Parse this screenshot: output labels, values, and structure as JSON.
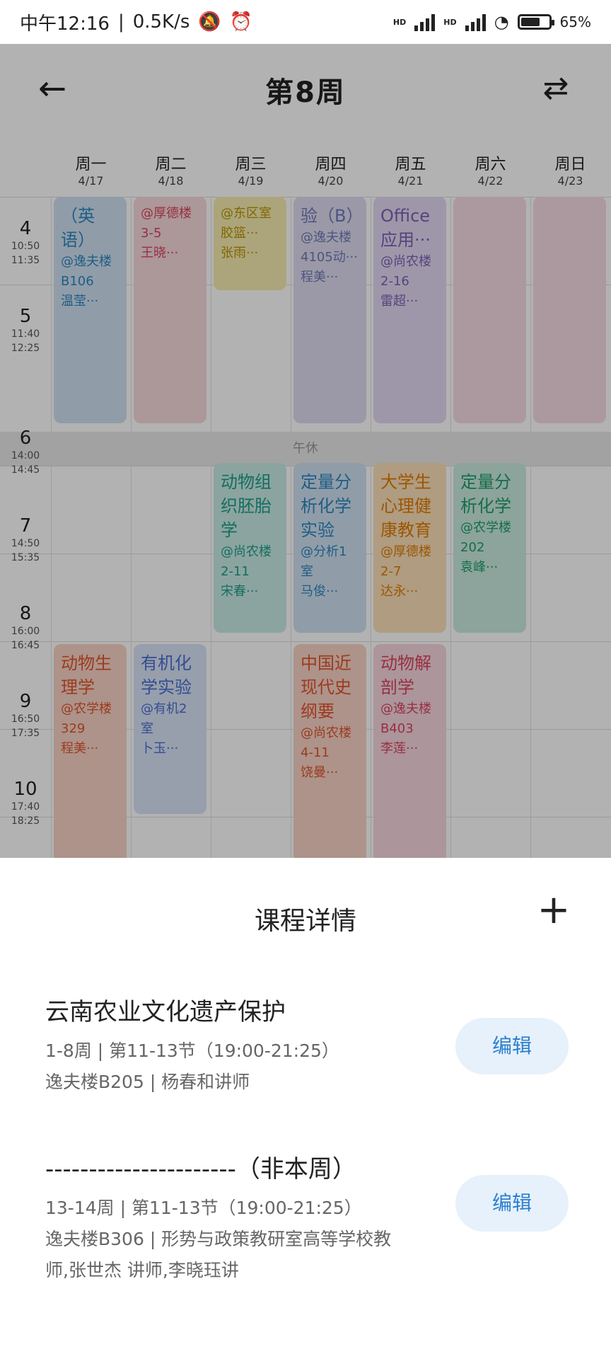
{
  "status_bar": {
    "time": "中午12:16",
    "speed": "0.5K/s",
    "battery": "65%",
    "signal1": "HD",
    "signal2": "HD",
    "icons": [
      "bell-off-icon",
      "alarm-icon",
      "signal-icon",
      "wifi-icon",
      "battery-icon"
    ]
  },
  "header": {
    "title": "第8周",
    "back_icon": "back-arrow-icon",
    "switch_icon": "swap-icon"
  },
  "days": [
    {
      "name": "周一",
      "date": "4/17"
    },
    {
      "name": "周二",
      "date": "4/18"
    },
    {
      "name": "周三",
      "date": "4/19"
    },
    {
      "name": "周四",
      "date": "4/20"
    },
    {
      "name": "周五",
      "date": "4/21"
    },
    {
      "name": "周六",
      "date": "4/22"
    },
    {
      "name": "周日",
      "date": "4/23"
    }
  ],
  "slots": [
    {
      "no": "4",
      "start": "10:50",
      "end": "11:35"
    },
    {
      "no": "5",
      "start": "11:40",
      "end": "12:25"
    },
    {
      "no": "6",
      "start": "14:00",
      "end": "14:45"
    },
    {
      "no": "7",
      "start": "14:50",
      "end": "15:35"
    },
    {
      "no": "8",
      "start": "16:00",
      "end": "16:45"
    },
    {
      "no": "9",
      "start": "16:50",
      "end": "17:35"
    },
    {
      "no": "10",
      "start": "17:40",
      "end": "18:25"
    }
  ],
  "lunch_label": "午休",
  "cards": [
    {
      "name": "（英语）",
      "loc": "@逸夫楼B106",
      "teacher": "温莹···",
      "color": "#2e86c1"
    },
    {
      "name": "",
      "loc": "@厚德楼3-5",
      "teacher": "王晓···",
      "color": "#d9465f"
    },
    {
      "name": "",
      "loc": "@东区室胶篮···",
      "teacher": "张雨···",
      "color": "#b89400"
    },
    {
      "name": "验（B）",
      "loc": "@逸夫楼4105动···",
      "teacher": "程美···",
      "color": "#6e79b8"
    },
    {
      "name": "Office应用···",
      "loc": "@尚农楼2-16",
      "teacher": "雷超···",
      "color": "#7a62b5"
    },
    {
      "name": "动物组织胚胎学",
      "loc": "@尚农楼2-11",
      "teacher": "宋春···",
      "color": "#1f9c8c"
    },
    {
      "name": "定量分析化学实验",
      "loc": "@分析1室",
      "teacher": "马俊···",
      "color": "#2e86c1"
    },
    {
      "name": "大学生心理健康教育",
      "loc": "@厚德楼2-7",
      "teacher": "达永···",
      "color": "#e07b00"
    },
    {
      "name": "定量分析化学",
      "loc": "@农学楼202",
      "teacher": "袁峰···",
      "color": "#1f9c6c"
    },
    {
      "name": "动物生理学",
      "loc": "@农学楼329",
      "teacher": "程美···",
      "color": "#e0542f"
    },
    {
      "name": "有机化学实验",
      "loc": "@有机2室",
      "teacher": "卜玉···",
      "color": "#4a6fd0"
    },
    {
      "name": "中国近现代史纲要",
      "loc": "@尚农楼4-11",
      "teacher": "饶曼···",
      "color": "#e0542f"
    },
    {
      "name": "动物解剖学",
      "loc": "@逸夫楼B403",
      "teacher": "李莲···",
      "color": "#d9465f"
    }
  ],
  "sheet": {
    "title": "课程详情",
    "add_icon": "plus-icon",
    "courses": [
      {
        "name": "云南农业文化遗产保护",
        "line1": "1-8周 | 第11-13节（19:00-21:25）",
        "line2": "逸夫楼B205 | 杨春和讲师",
        "edit": "编辑"
      },
      {
        "name": "----------------------（非本周）",
        "line1": "13-14周 | 第11-13节（19:00-21:25）",
        "line2": "逸夫楼B306 | 形势与政策教研室高等学校教师,张世杰 讲师,李晓珏讲",
        "edit": "编辑"
      }
    ]
  }
}
